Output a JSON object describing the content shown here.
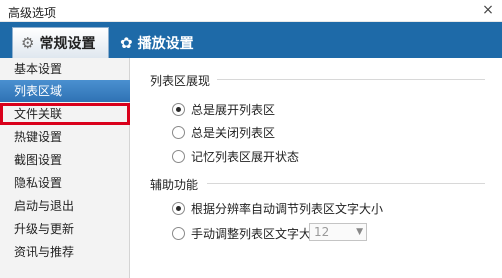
{
  "window": {
    "title": "高级选项",
    "close_label": "×"
  },
  "tabs": [
    {
      "label": "常规设置",
      "icon": "gear-icon"
    },
    {
      "label": "播放设置",
      "icon": "film-reel-icon"
    }
  ],
  "sidebar": {
    "items": [
      {
        "label": "基本设置"
      },
      {
        "label": "列表区域"
      },
      {
        "label": "文件关联"
      },
      {
        "label": "热键设置"
      },
      {
        "label": "截图设置"
      },
      {
        "label": "隐私设置"
      },
      {
        "label": "启动与退出"
      },
      {
        "label": "升级与更新"
      },
      {
        "label": "资讯与推荐"
      }
    ],
    "active_index": 1,
    "highlighted_index": 2
  },
  "content": {
    "list_section": {
      "heading": "列表区展现",
      "options": [
        "总是展开列表区",
        "总是关闭列表区",
        "记忆列表区展开状态"
      ],
      "selected_index": 0
    },
    "assist_section": {
      "heading": "辅助功能",
      "options": [
        "根据分辨率自动调节列表区文字大小",
        "手动调整列表区文字大小"
      ],
      "selected_index": 0,
      "font_size_value": "12"
    }
  },
  "colors": {
    "tabbar": "#1e6aa8",
    "active_item": "#3a80c4",
    "highlight_border": "#d9001b"
  }
}
